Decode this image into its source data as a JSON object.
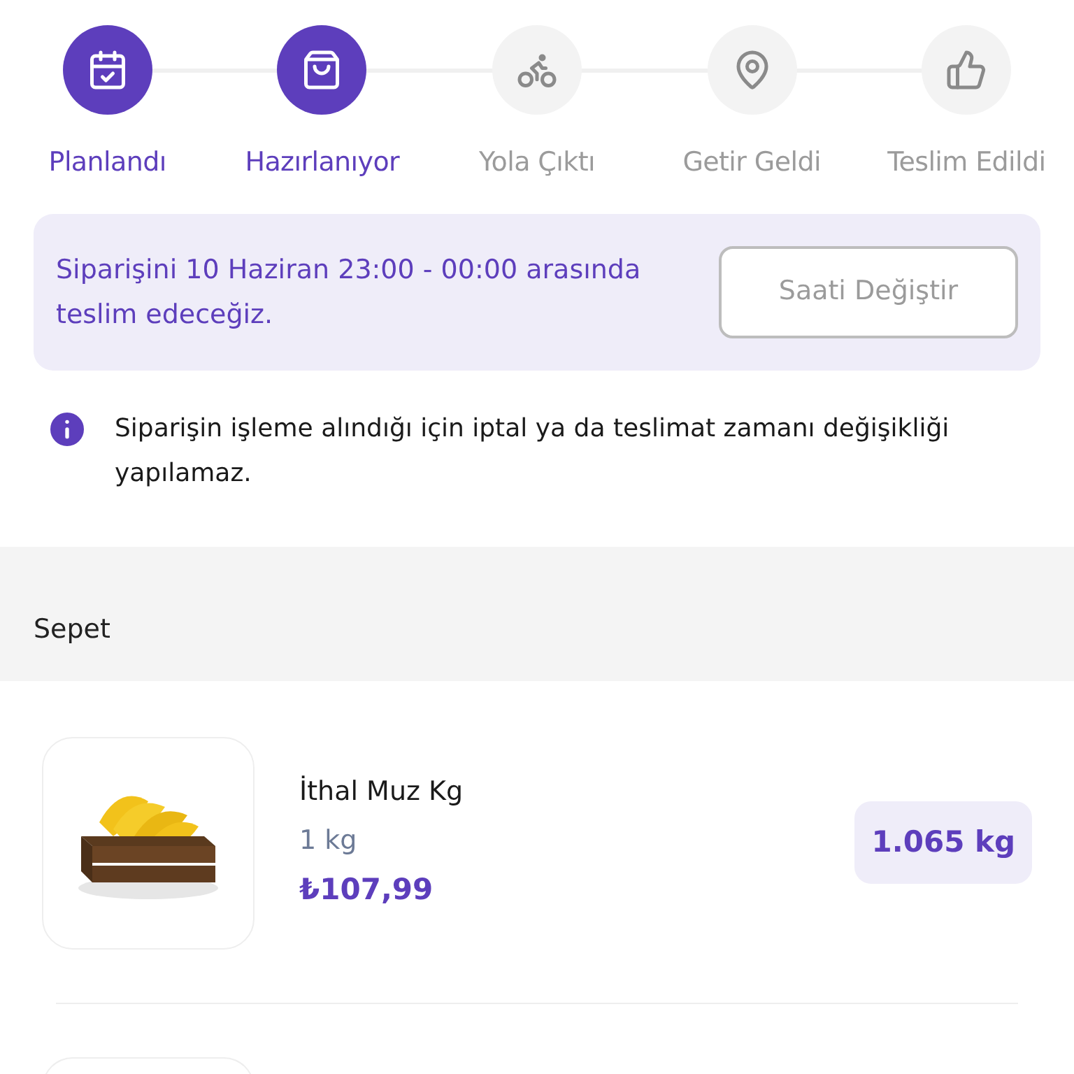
{
  "steps": [
    {
      "label": "Planlandı",
      "kind": "calendar",
      "done": true
    },
    {
      "label": "Hazırlanıyor",
      "kind": "bag",
      "done": true
    },
    {
      "label": "Yola Çıktı",
      "kind": "scooter",
      "done": false
    },
    {
      "label": "Getir Geldi",
      "kind": "pin",
      "done": false
    },
    {
      "label": "Teslim Edildi",
      "kind": "thumbs",
      "done": false
    }
  ],
  "delivery_banner": {
    "text": "Siparişini 10 Haziran 23:00 - 00:00 arasında teslim edeceğiz.",
    "button": "Saati Değiştir"
  },
  "notice": "Siparişin işleme alındığı için iptal ya da teslimat zamanı değişikliği yapılamaz.",
  "section_title": "Sepet",
  "items": [
    {
      "name": "İthal Muz Kg",
      "unit": "1 kg",
      "price": "₺107,99",
      "quantity": "1.065 kg"
    }
  ]
}
